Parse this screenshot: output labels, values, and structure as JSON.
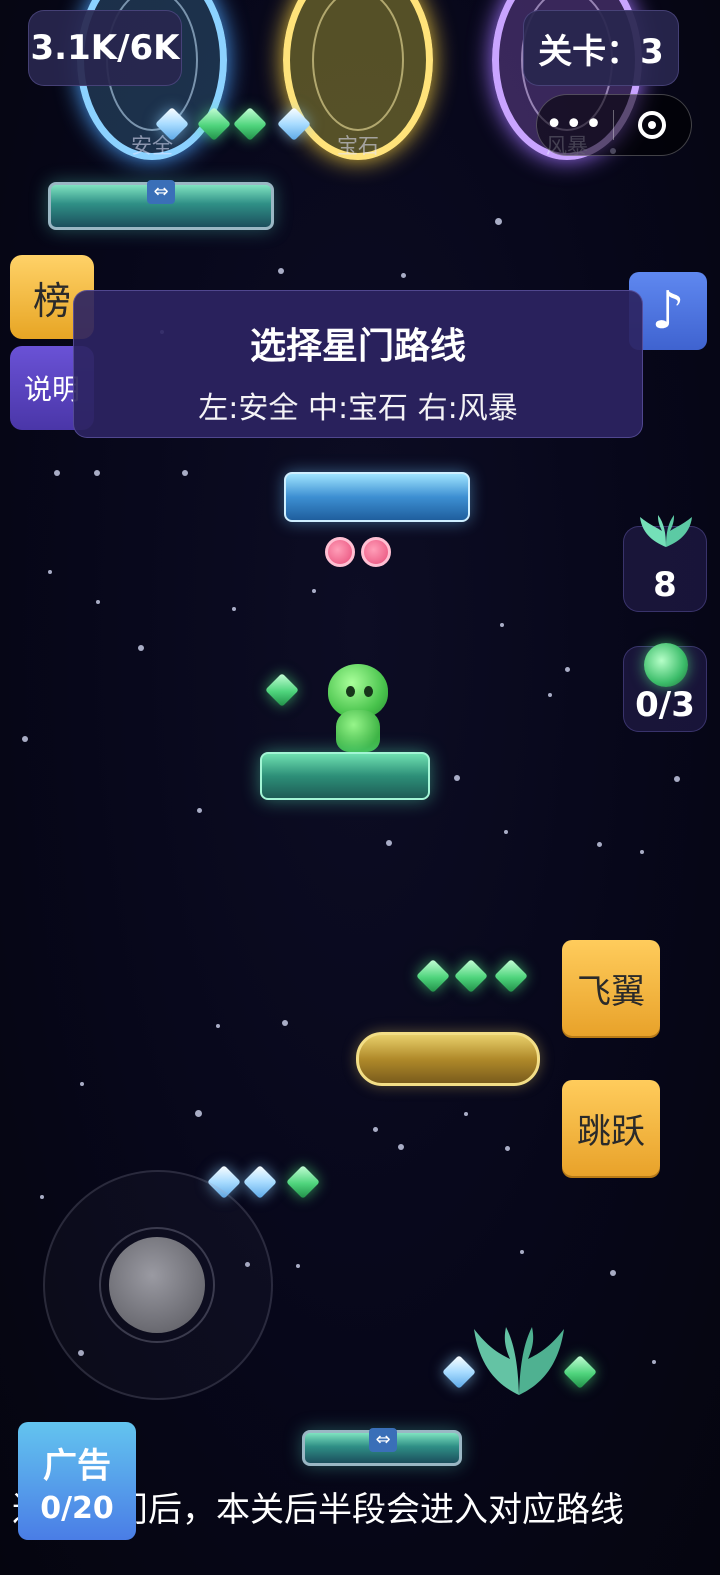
{
  "hud": {
    "score": "3.1K/6K",
    "level": "关卡：3",
    "menu_dots": "•••"
  },
  "gates": [
    {
      "label": "安全",
      "color": "#8cd2ff"
    },
    {
      "label": "宝石",
      "color": "#ffe37a"
    },
    {
      "label": "风暴",
      "color": "#c9a4ff"
    }
  ],
  "side": {
    "rank_label": "榜",
    "help_label": "说明",
    "music_symbol": "♪"
  },
  "notice": {
    "title": "选择星门路线",
    "subtitle": "左:安全  中:宝石  右:风暴"
  },
  "items": {
    "wings_count": "8",
    "orb_progress": "0/3"
  },
  "controls": {
    "fly_label": "飞翼",
    "jump_label": "跳跃"
  },
  "ad": {
    "title": "广告",
    "count": "0/20"
  },
  "ticker": "进入星门后，本关后半段会进入对应路线",
  "icons": {
    "platform_arrow": "⇔"
  }
}
